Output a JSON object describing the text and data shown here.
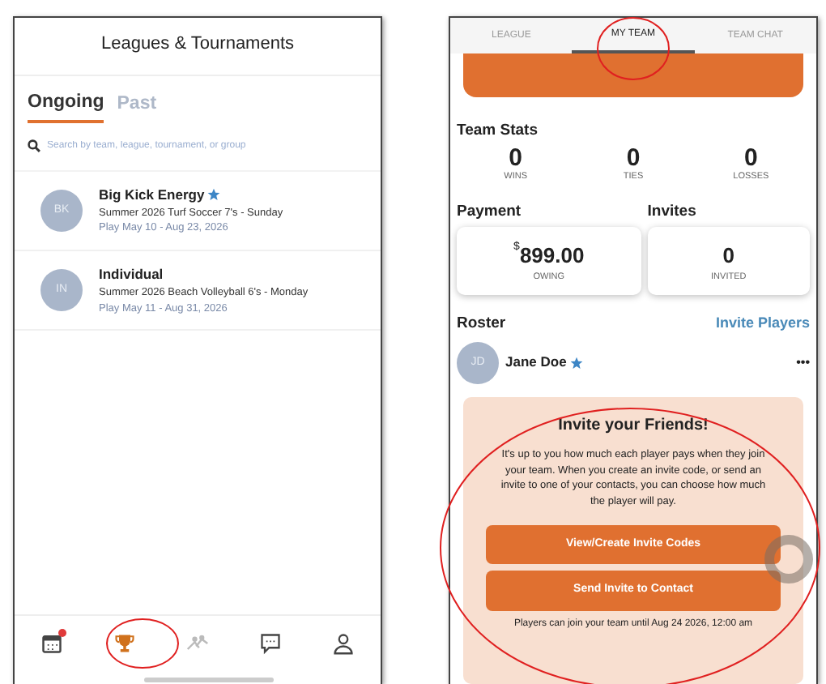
{
  "left_screen": {
    "title": "Leagues & Tournaments",
    "tabs": [
      {
        "label": "Ongoing",
        "selected": true
      },
      {
        "label": "Past",
        "selected": false
      }
    ],
    "search": {
      "placeholder": "Search by team, league, tournament, or group"
    },
    "teams": [
      {
        "initials": "BK",
        "name": "Big Kick Energy",
        "starred": true,
        "league": "Summer 2026 Turf Soccer 7's - Sunday",
        "dates": "Play May 10 - Aug 23, 2026"
      },
      {
        "initials": "IN",
        "name": "Individual",
        "starred": false,
        "league": "Summer 2026 Beach Volleyball 6's - Monday",
        "dates": "Play May 11 - Aug 31, 2026"
      }
    ],
    "bottom_nav": [
      {
        "kind": "calendar",
        "selected": false,
        "alert": true
      },
      {
        "kind": "trophy",
        "selected": true,
        "alert": false
      },
      {
        "kind": "players",
        "selected": false,
        "alert": false
      },
      {
        "kind": "chat",
        "selected": false,
        "alert": false
      },
      {
        "kind": "profile",
        "selected": false,
        "alert": false
      }
    ]
  },
  "right_screen": {
    "tabs": [
      {
        "label": "LEAGUE",
        "selected": false
      },
      {
        "label": "MY TEAM",
        "selected": true
      },
      {
        "label": "TEAM CHAT",
        "selected": false
      }
    ],
    "team_stats": {
      "title": "Team Stats",
      "stats": [
        {
          "value": "0",
          "label": "WINS"
        },
        {
          "value": "0",
          "label": "TIES"
        },
        {
          "value": "0",
          "label": "LOSSES"
        }
      ]
    },
    "payment": {
      "title": "Payment",
      "currency": "$",
      "amount": "899.00",
      "label": "OWING"
    },
    "invites": {
      "title": "Invites",
      "value": "0",
      "label": "INVITED"
    },
    "roster": {
      "title": "Roster",
      "action": "Invite Players",
      "players": [
        {
          "initials": "JD",
          "name": "Jane Doe",
          "starred": true,
          "menu": "•••"
        }
      ]
    },
    "invite_card": {
      "title": "Invite your Friends!",
      "text": "It's up to you how much each player pays when they join your team. When you create an invite code, or send an invite to one of your contacts, you can choose how much the player will pay.",
      "buttons": [
        "View/Create Invite Codes",
        "Send Invite to Contact"
      ],
      "footer": "Players can join your team until Aug 24 2026, 12:00 am"
    }
  }
}
